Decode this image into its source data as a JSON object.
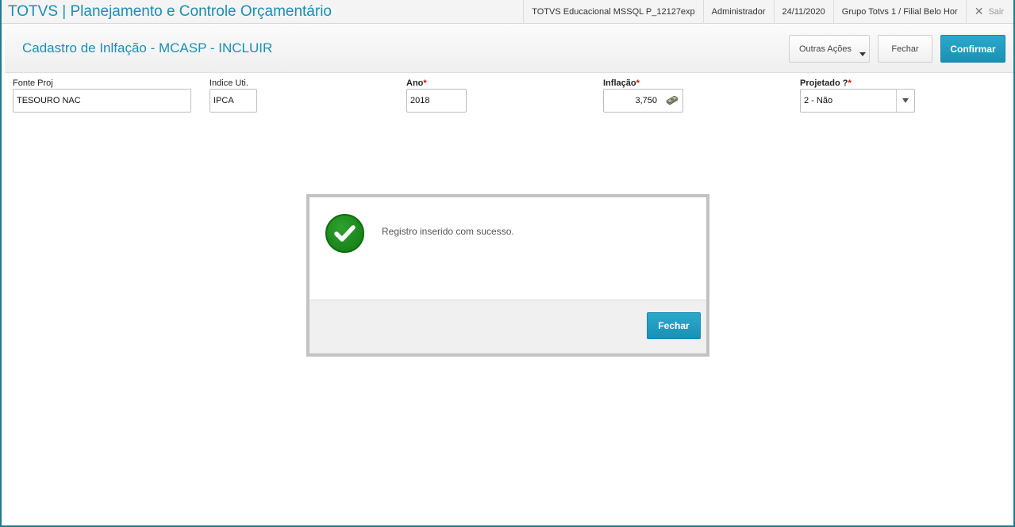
{
  "topbar": {
    "app_title": "TOTVS | Planejamento e Controle Orçamentário",
    "database": "TOTVS Educacional MSSQL P_12127exp",
    "user": "Administrador",
    "date": "24/11/2020",
    "branch": "Grupo Totvs 1 / Filial Belo Hor",
    "exit_label": "Sair"
  },
  "header": {
    "title": "Cadastro de Inlfação - MCASP - INCLUIR",
    "other_actions_label": "Outras Ações",
    "close_label": "Fechar",
    "confirm_label": "Confirmar"
  },
  "form": {
    "fonte_proj": {
      "label": "Fonte Proj",
      "value": "TESOURO NAC"
    },
    "indice_uti": {
      "label": "Indice Uti.",
      "value": "IPCA"
    },
    "ano": {
      "label": "Ano",
      "required_mark": "*",
      "value": "2018"
    },
    "inflacao": {
      "label": "Inflação",
      "required_mark": "*",
      "value": "3,750"
    },
    "projetado": {
      "label": "Projetado ?",
      "required_mark": "*",
      "value": "2 - Não"
    }
  },
  "dialog": {
    "message": "Registro inserido com sucesso.",
    "close_label": "Fechar"
  },
  "colors": {
    "accent": "#1a8fb3",
    "primary_button": "#1b90b5",
    "success": "#1a8c1c",
    "required": "#e00000"
  }
}
